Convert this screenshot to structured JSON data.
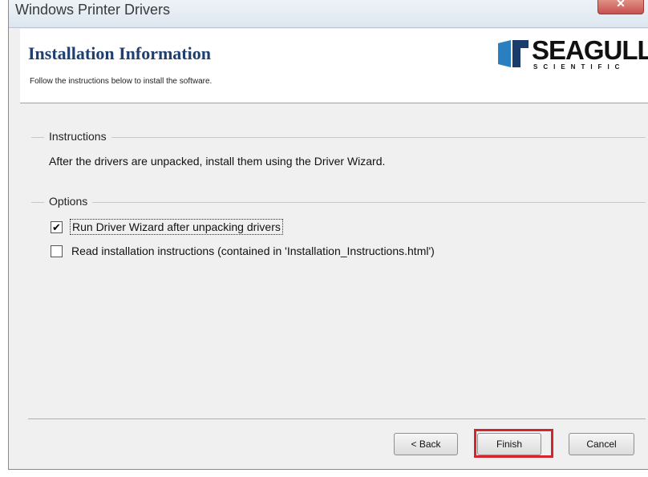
{
  "window": {
    "title": "Windows Printer Drivers",
    "close_glyph": "✕"
  },
  "header": {
    "title": "Installation Information",
    "subtitle": "Follow the instructions below to install the software.",
    "logo_text": "SEAGULL",
    "logo_subtext": "SCIENTIFIC"
  },
  "instructions": {
    "label": "Instructions",
    "text": "After the drivers are unpacked, install them using the Driver Wizard."
  },
  "options": {
    "label": "Options",
    "items": [
      {
        "label": "Run Driver Wizard after unpacking drivers",
        "checked": true,
        "mark": "✔"
      },
      {
        "label": "Read installation instructions (contained in 'Installation_Instructions.html')",
        "checked": false,
        "mark": ""
      }
    ]
  },
  "buttons": {
    "back": "< Back",
    "finish": "Finish",
    "cancel": "Cancel"
  },
  "colors": {
    "title_blue": "#1f3f6e",
    "highlight_red": "#d3252b"
  }
}
